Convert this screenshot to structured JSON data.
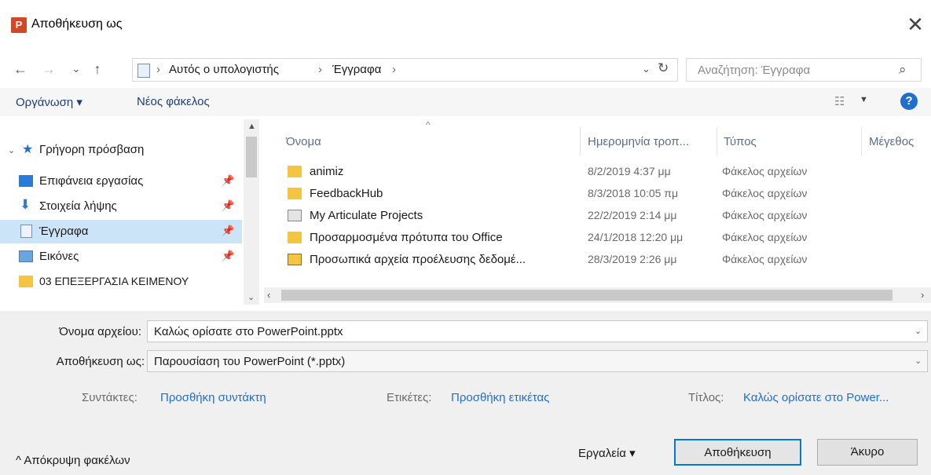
{
  "window": {
    "title": "Αποθήκευση ως",
    "app_icon": "P",
    "close": "✕"
  },
  "nav": {
    "back": "←",
    "forward": "→",
    "recent": "⌄",
    "up": "↑",
    "breadcrumbs": [
      "Αυτός ο υπολογιστής",
      "Έγγραφα"
    ],
    "sep": "›",
    "search_placeholder": "Αναζήτηση: Έγγραφα",
    "refresh": "↻",
    "search_icon": "⌕"
  },
  "toolbar": {
    "organize": "Οργάνωση ▾",
    "new_folder": "Νέος φάκελος",
    "view": "☷",
    "help": "?"
  },
  "sidebar": {
    "quick_access": "Γρήγορη πρόσβαση",
    "items": [
      {
        "label": "Επιφάνεια εργασίας",
        "icon": "desktop-icon",
        "pinned": true
      },
      {
        "label": "Στοιχεία λήψης",
        "icon": "download-icon",
        "pinned": true
      },
      {
        "label": "Έγγραφα",
        "icon": "documents-icon",
        "pinned": true,
        "selected": true
      },
      {
        "label": "Εικόνες",
        "icon": "pictures-icon",
        "pinned": true
      },
      {
        "label": "03 ΕΠΕΞΕΡΓΑΣΙΑ ΚΕΙΜΕΝΟΥ",
        "icon": "folder-icon",
        "pinned": false
      }
    ]
  },
  "columns": {
    "name": "Όνομα",
    "date": "Ημερομηνία τροπ...",
    "type": "Τύπος",
    "size": "Μέγεθος"
  },
  "files": [
    {
      "name": "animiz",
      "date": "8/2/2019 4:37 μμ",
      "type": "Φάκελος αρχείων",
      "icon": "folder-icon"
    },
    {
      "name": "FeedbackHub",
      "date": "8/3/2018 10:05 πμ",
      "type": "Φάκελος αρχείων",
      "icon": "folder-icon"
    },
    {
      "name": "My Articulate Projects",
      "date": "22/2/2019 2:14 μμ",
      "type": "Φάκελος αρχείων",
      "icon": "special-folder-icon"
    },
    {
      "name": "Προσαρμοσμένα πρότυπα του Office",
      "date": "24/1/2018 12:20 μμ",
      "type": "Φάκελος αρχείων",
      "icon": "folder-icon"
    },
    {
      "name": "Προσωπικά αρχεία προέλευσης δεδομέ...",
      "date": "28/3/2019 2:26 μμ",
      "type": "Φάκελος αρχείων",
      "icon": "data-folder-icon"
    }
  ],
  "form": {
    "filename_label": "Όνομα αρχείου:",
    "filename_value": "Καλώς ορίσατε στο PowerPoint.pptx",
    "savetype_label": "Αποθήκευση ως:",
    "savetype_value": "Παρουσίαση του PowerPoint (*.pptx)",
    "authors_label": "Συντάκτες:",
    "authors_value": "Προσθήκη συντάκτη",
    "tags_label": "Ετικέτες:",
    "tags_value": "Προσθήκη ετικέτας",
    "title_label": "Τίτλος:",
    "title_value": "Καλώς ορίσατε στο Power..."
  },
  "footer": {
    "hide_folders": "^ Απόκρυψη φακέλων",
    "tools": "Εργαλεία  ▾",
    "save": "Αποθήκευση",
    "cancel": "Άκυρο"
  },
  "colors": {
    "accent": "#0078d7",
    "link": "#1f6fd0",
    "selection": "#cce4f7",
    "folder": "#f5c542"
  }
}
